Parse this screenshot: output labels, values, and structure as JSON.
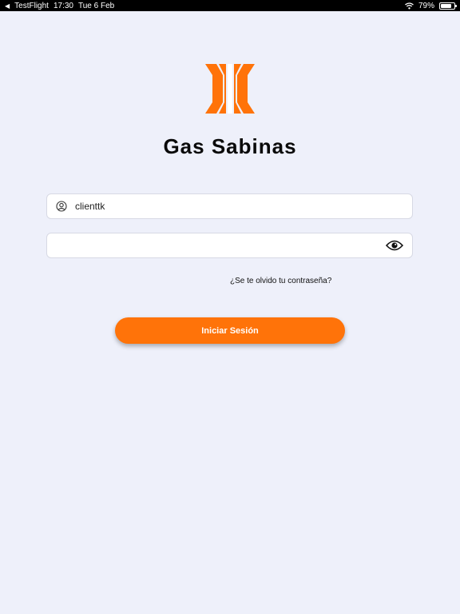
{
  "status_bar": {
    "app": "TestFlight",
    "time": "17:30",
    "date": "Tue 6 Feb",
    "battery": "79%",
    "battery_level": 0.79
  },
  "app_title": "Gas Sabinas",
  "login_form": {
    "username_value": "clienttk",
    "password_value": "",
    "forgot_password_label": "¿Se te olvido tu contraseña?",
    "submit_label": "Iniciar Sesión"
  },
  "icons": {
    "logo": "gas-sabinas-logo",
    "user": "user-circle-icon",
    "password_toggle": "eye-icon"
  },
  "colors": {
    "background": "#eef0fa",
    "accent": "#ff7309"
  }
}
